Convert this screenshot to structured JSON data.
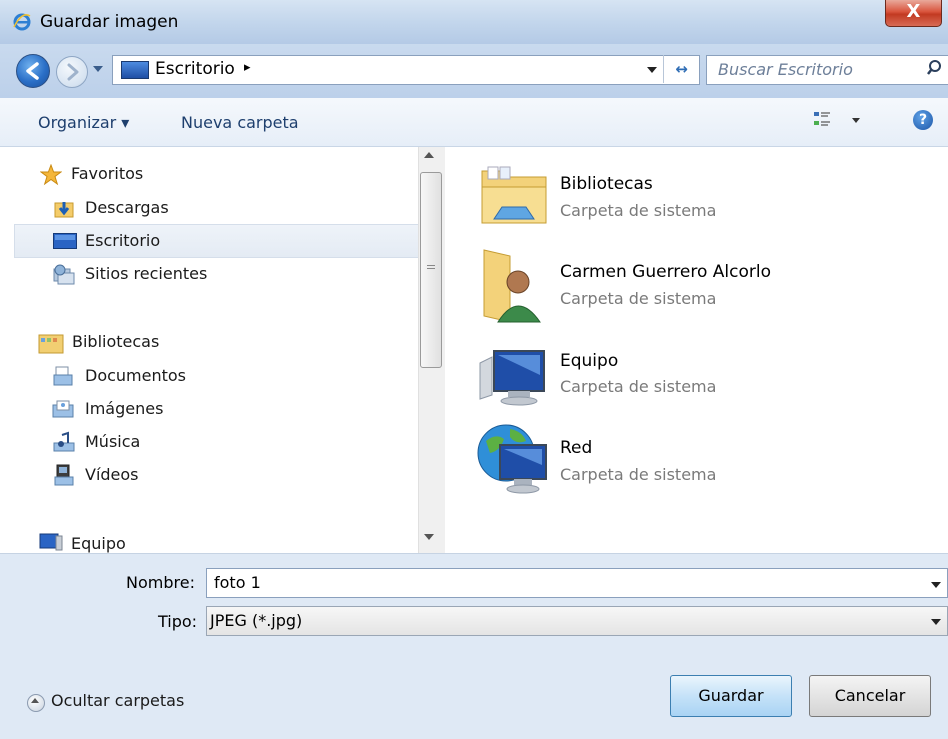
{
  "window": {
    "title": "Guardar imagen",
    "close_label": "X"
  },
  "address": {
    "location": "Escritorio",
    "separator": "▸",
    "search_placeholder": "Buscar Escritorio"
  },
  "toolbar": {
    "organize_label": "Organizar ▾",
    "new_folder_label": "Nueva carpeta",
    "help_label": "?"
  },
  "nav": {
    "favorites": {
      "label": "Favoritos",
      "items": [
        "Descargas",
        "Escritorio",
        "Sitios recientes"
      ]
    },
    "libraries": {
      "label": "Bibliotecas",
      "items": [
        "Documentos",
        "Imágenes",
        "Música",
        "Vídeos"
      ]
    },
    "computer": {
      "label": "Equipo"
    },
    "selected": "Escritorio"
  },
  "content": {
    "items": [
      {
        "name": "Bibliotecas",
        "type": "Carpeta de sistema",
        "icon": "libraries-folder-icon"
      },
      {
        "name": "Carmen Guerrero Alcorlo",
        "type": "Carpeta de sistema",
        "icon": "user-folder-icon"
      },
      {
        "name": "Equipo",
        "type": "Carpeta de sistema",
        "icon": "computer-icon"
      },
      {
        "name": "Red",
        "type": "Carpeta de sistema",
        "icon": "network-icon"
      }
    ]
  },
  "form": {
    "name_label": "Nombre:",
    "name_value": "foto 1",
    "type_label": "Tipo:",
    "type_value": "JPEG (*.jpg)"
  },
  "footer": {
    "hide_folders_label": "Ocultar carpetas",
    "save_label": "Guardar",
    "cancel_label": "Cancelar"
  },
  "colors": {
    "accent": "#2a6fc7",
    "window_bg": "#dfe9f5",
    "link_text": "#1e3f6e",
    "secondary_text": "#7a7a7a"
  }
}
